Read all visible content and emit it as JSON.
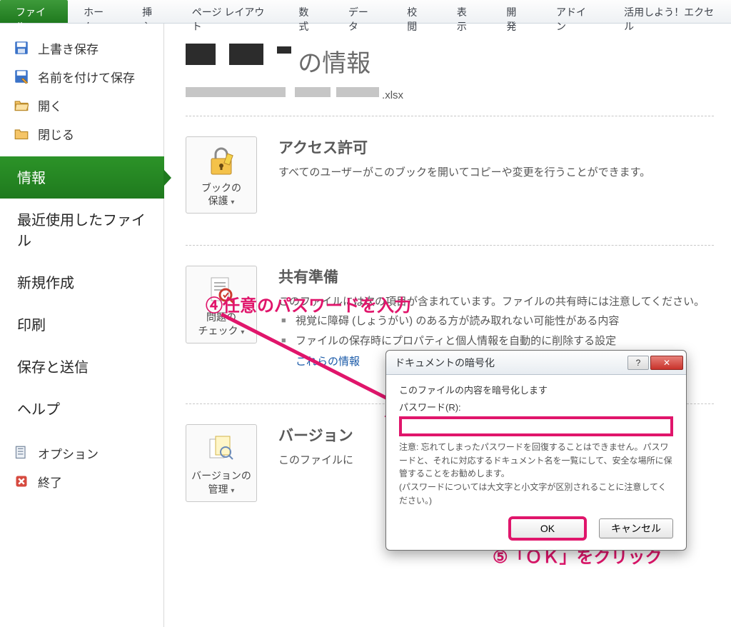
{
  "ribbon": {
    "tabs": [
      "ファイル",
      "ホーム",
      "挿入",
      "ページ レイアウト",
      "数式",
      "データ",
      "校閲",
      "表示",
      "開発",
      "アドイン",
      "活用しよう！エクセル"
    ],
    "active_index": 0
  },
  "sidebar": {
    "items": [
      {
        "label": "上書き保存",
        "icon": "save-icon"
      },
      {
        "label": "名前を付けて保存",
        "icon": "save-as-icon"
      },
      {
        "label": "開く",
        "icon": "folder-open-icon"
      },
      {
        "label": "閉じる",
        "icon": "folder-close-icon"
      }
    ],
    "selected_label": "情報",
    "big_items": [
      "最近使用したファイル",
      "新規作成",
      "印刷",
      "保存と送信",
      "ヘルプ"
    ],
    "bottom_items": [
      {
        "label": "オプション",
        "icon": "options-icon"
      },
      {
        "label": "終了",
        "icon": "exit-icon"
      }
    ]
  },
  "content": {
    "title_suffix": " の情報",
    "file_ext": ".xlsx",
    "sections": {
      "permission": {
        "heading": "アクセス許可",
        "text": "すべてのユーザーがこのブックを開いてコピーや変更を行うことができます。",
        "btn_line1": "ブックの",
        "btn_line2": "保護"
      },
      "share": {
        "heading": "共有準備",
        "text": "このファイルには次の項目が含まれています。ファイルの共有時には注意してください。",
        "bullet1": "視覚に障碍 (しょうがい) のある方が読み取れない可能性がある内容",
        "bullet2_a": "ファイルの保存時にプロパティと個人情報を自動的に削除する設定",
        "bullet2_link": "これらの情報",
        "btn_line1": "問題の",
        "btn_line2": "チェック"
      },
      "version": {
        "heading": "バージョン",
        "text": "このファイルに",
        "btn_line1": "バージョンの",
        "btn_line2": "管理"
      }
    }
  },
  "dialog": {
    "title": "ドキュメントの暗号化",
    "subtitle": "このファイルの内容を暗号化します",
    "pw_label": "パスワード(R):",
    "note": "注意: 忘れてしまったパスワードを回復することはできません。パスワードと、それに対応するドキュメント名を一覧にして、安全な場所に保管することをお勧めします。\n(パスワードについては大文字と小文字が区別されることに注意してください。)",
    "ok": "OK",
    "cancel": "キャンセル"
  },
  "annotations": {
    "step4": "④任意のパスワードを入力",
    "step5": "⑤「ＯＫ」をクリック"
  }
}
